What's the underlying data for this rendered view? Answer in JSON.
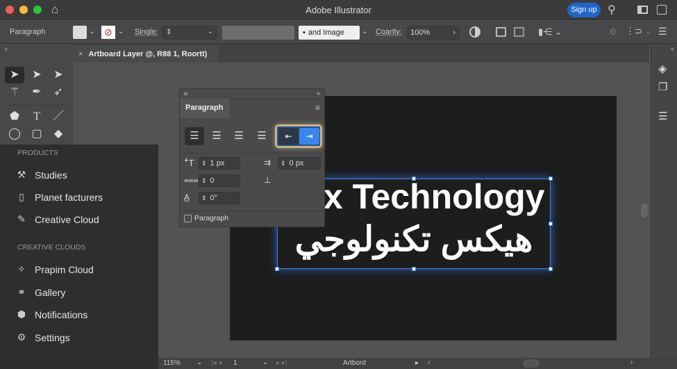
{
  "window": {
    "title": "Adobe Illustrator",
    "signup": "Sign up"
  },
  "control": {
    "panel_label": "Paragraph",
    "single_label": "Single:",
    "image_field": "▪   and Image",
    "opacity_label": "Coartly:",
    "opacity_value": "100%"
  },
  "doc_tab": {
    "title": "Artboard Layer @, R88 1, Roortt)"
  },
  "menu": {
    "sections": [
      {
        "title": "PRODUCTS",
        "items": [
          {
            "label": "Studies",
            "icon": "tools-icon"
          },
          {
            "label": "Planet facturers",
            "icon": "document-icon"
          },
          {
            "label": "Creative Cloud",
            "icon": "brush-icon"
          }
        ]
      },
      {
        "title": "CREATIVE CLOUDS",
        "items": [
          {
            "label": "Prapim Cloud",
            "icon": "sparkle-icon"
          },
          {
            "label": "Gallery",
            "icon": "link-icon"
          },
          {
            "label": "Notifications",
            "icon": "cube-icon"
          },
          {
            "label": "Settings",
            "icon": "gear-icon"
          }
        ]
      }
    ]
  },
  "paragraph_panel": {
    "title": "Paragraph",
    "left_indent": "1 px",
    "right_indent": "0 px",
    "space_before": "0",
    "space_after": "0",
    "hyphen_angle": "0°",
    "checkbox_label": "Paragraph",
    "checkbox_checked": false
  },
  "artboard": {
    "text_en": "Hex Technology",
    "text_ar": "هيكس تكنولوجي"
  },
  "status": {
    "zoom": "115%",
    "page": "1",
    "label": "Artbord"
  },
  "colors": {
    "accent": "#1f66c9",
    "selection": "#3b82f6"
  }
}
